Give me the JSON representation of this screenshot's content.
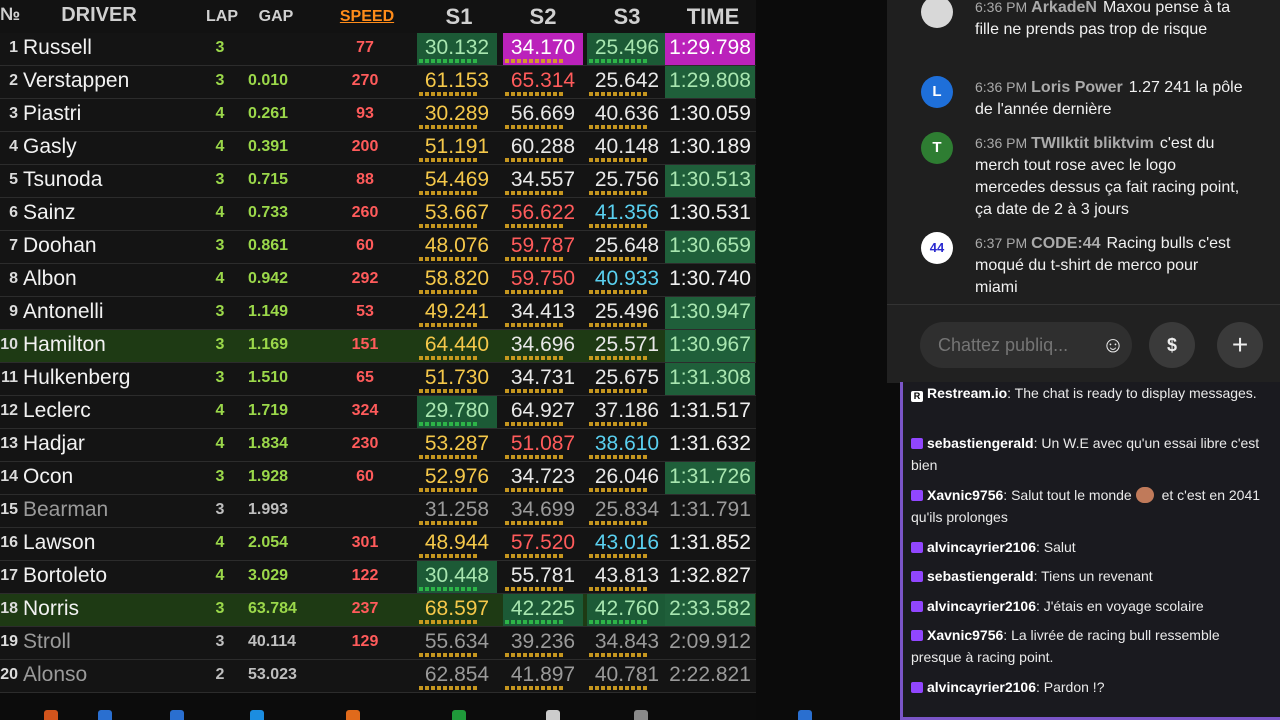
{
  "timing": {
    "headers": {
      "pos": "№",
      "driver": "DRIVER",
      "lap": "LAP",
      "gap": "GAP",
      "speed": "SPEED",
      "s1": "S1",
      "s2": "S2",
      "s3": "S3",
      "time": "TIME"
    },
    "header_colors": {
      "speed": "#ff8c1a",
      "default": "#d0d0d0"
    },
    "sector_colors": {
      "purple": "#bb22bb",
      "green_bg": "#1c5a36",
      "green_text": "#a8e6b0",
      "yellow": "#f5c84a",
      "red": "#ff5b5b",
      "white": "#e8e8e8",
      "cyan": "#5ad0f0",
      "green_time_bg": "#1f5f3a"
    },
    "rows": [
      {
        "pos": "1",
        "driver": "Russell",
        "lap": "3",
        "gap": "",
        "speed": "77",
        "s1": "30.132",
        "s2": "34.170",
        "s3": "25.496",
        "time": "1:29.798",
        "c1": "green",
        "c2": "purple",
        "c3": "green",
        "ct": "purple"
      },
      {
        "pos": "2",
        "driver": "Verstappen",
        "lap": "3",
        "gap": "0.010",
        "speed": "270",
        "s1": "61.153",
        "s2": "65.314",
        "s3": "25.642",
        "time": "1:29.808",
        "c1": "yellow",
        "c2": "red",
        "c3": "white",
        "ct": "green"
      },
      {
        "pos": "3",
        "driver": "Piastri",
        "lap": "4",
        "gap": "0.261",
        "speed": "93",
        "s1": "30.289",
        "s2": "56.669",
        "s3": "40.636",
        "time": "1:30.059",
        "c1": "yellow",
        "c2": "white",
        "c3": "white",
        "ct": "white"
      },
      {
        "pos": "4",
        "driver": "Gasly",
        "lap": "4",
        "gap": "0.391",
        "speed": "200",
        "s1": "51.191",
        "s2": "60.288",
        "s3": "40.148",
        "time": "1:30.189",
        "c1": "yellow",
        "c2": "white",
        "c3": "white",
        "ct": "white"
      },
      {
        "pos": "5",
        "driver": "Tsunoda",
        "lap": "3",
        "gap": "0.715",
        "speed": "88",
        "s1": "54.469",
        "s2": "34.557",
        "s3": "25.756",
        "time": "1:30.513",
        "c1": "yellow",
        "c2": "white",
        "c3": "white",
        "ct": "green"
      },
      {
        "pos": "6",
        "driver": "Sainz",
        "lap": "4",
        "gap": "0.733",
        "speed": "260",
        "s1": "53.667",
        "s2": "56.622",
        "s3": "41.356",
        "time": "1:30.531",
        "c1": "yellow",
        "c2": "red",
        "c3": "cyan",
        "ct": "white"
      },
      {
        "pos": "7",
        "driver": "Doohan",
        "lap": "3",
        "gap": "0.861",
        "speed": "60",
        "s1": "48.076",
        "s2": "59.787",
        "s3": "25.648",
        "time": "1:30.659",
        "c1": "yellow",
        "c2": "red",
        "c3": "white",
        "ct": "green"
      },
      {
        "pos": "8",
        "driver": "Albon",
        "lap": "4",
        "gap": "0.942",
        "speed": "292",
        "s1": "58.820",
        "s2": "59.750",
        "s3": "40.933",
        "time": "1:30.740",
        "c1": "yellow",
        "c2": "red",
        "c3": "cyan",
        "ct": "white"
      },
      {
        "pos": "9",
        "driver": "Antonelli",
        "lap": "3",
        "gap": "1.149",
        "speed": "53",
        "s1": "49.241",
        "s2": "34.413",
        "s3": "25.496",
        "time": "1:30.947",
        "c1": "yellow",
        "c2": "white",
        "c3": "white",
        "ct": "green"
      },
      {
        "pos": "10",
        "driver": "Hamilton",
        "lap": "3",
        "gap": "1.169",
        "speed": "151",
        "s1": "64.440",
        "s2": "34.696",
        "s3": "25.571",
        "time": "1:30.967",
        "c1": "yellow",
        "c2": "white",
        "c3": "white",
        "ct": "green",
        "hl": true
      },
      {
        "pos": "11",
        "driver": "Hulkenberg",
        "lap": "3",
        "gap": "1.510",
        "speed": "65",
        "s1": "51.730",
        "s2": "34.731",
        "s3": "25.675",
        "time": "1:31.308",
        "c1": "yellow",
        "c2": "white",
        "c3": "white",
        "ct": "green"
      },
      {
        "pos": "12",
        "driver": "Leclerc",
        "lap": "4",
        "gap": "1.719",
        "speed": "324",
        "s1": "29.780",
        "s2": "64.927",
        "s3": "37.186",
        "time": "1:31.517",
        "c1": "green",
        "c2": "white",
        "c3": "white",
        "ct": "white"
      },
      {
        "pos": "13",
        "driver": "Hadjar",
        "lap": "4",
        "gap": "1.834",
        "speed": "230",
        "s1": "53.287",
        "s2": "51.087",
        "s3": "38.610",
        "time": "1:31.632",
        "c1": "yellow",
        "c2": "red",
        "c3": "cyan",
        "ct": "white"
      },
      {
        "pos": "14",
        "driver": "Ocon",
        "lap": "3",
        "gap": "1.928",
        "speed": "60",
        "s1": "52.976",
        "s2": "34.723",
        "s3": "26.046",
        "time": "1:31.726",
        "c1": "yellow",
        "c2": "white",
        "c3": "white",
        "ct": "green"
      },
      {
        "pos": "15",
        "driver": "Bearman",
        "lap": "3",
        "gap": "1.993",
        "speed": "",
        "s1": "31.258",
        "s2": "34.699",
        "s3": "25.834",
        "time": "1:31.791",
        "c1": "white",
        "c2": "white",
        "c3": "white",
        "ct": "white",
        "dim": true
      },
      {
        "pos": "16",
        "driver": "Lawson",
        "lap": "4",
        "gap": "2.054",
        "speed": "301",
        "s1": "48.944",
        "s2": "57.520",
        "s3": "43.016",
        "time": "1:31.852",
        "c1": "yellow",
        "c2": "red",
        "c3": "cyan",
        "ct": "white"
      },
      {
        "pos": "17",
        "driver": "Bortoleto",
        "lap": "4",
        "gap": "3.029",
        "speed": "122",
        "s1": "30.448",
        "s2": "55.781",
        "s3": "43.813",
        "time": "1:32.827",
        "c1": "green",
        "c2": "white",
        "c3": "white",
        "ct": "white"
      },
      {
        "pos": "18",
        "driver": "Norris",
        "lap": "3",
        "gap": "63.784",
        "speed": "237",
        "s1": "68.597",
        "s2": "42.225",
        "s3": "42.760",
        "time": "2:33.582",
        "c1": "yellow",
        "c2": "green",
        "c3": "green",
        "ct": "green",
        "hl": true
      },
      {
        "pos": "19",
        "driver": "Stroll",
        "lap": "3",
        "gap": "40.114",
        "speed": "129",
        "s1": "55.634",
        "s2": "39.236",
        "s3": "34.843",
        "time": "2:09.912",
        "c1": "white",
        "c2": "white",
        "c3": "white",
        "ct": "white",
        "dim": true
      },
      {
        "pos": "20",
        "driver": "Alonso",
        "lap": "2",
        "gap": "53.023",
        "speed": "",
        "s1": "62.854",
        "s2": "41.897",
        "s3": "40.781",
        "time": "2:22.821",
        "c1": "white",
        "c2": "white",
        "c3": "white",
        "ct": "white",
        "dim": true
      }
    ]
  },
  "youtube_chat": {
    "messages": [
      {
        "time": "6:36 PM",
        "author": "ArkadeN",
        "text": "Maxou pense à ta fille ne prends pas trop de risque",
        "avatar_letter": "",
        "avatar_color": "#d8d8d8"
      },
      {
        "time": "6:36 PM",
        "author": "Loris Power",
        "text": "1.27 241 la pôle de l'année dernière",
        "avatar_letter": "L",
        "avatar_color": "#1e6fd9"
      },
      {
        "time": "6:36 PM",
        "author": "TWIlktit bliktvim",
        "text": "c'est du merch tout rose avec le logo mercedes dessus ça fait racing point, ça date de 2 à 3 jours",
        "avatar_letter": "T",
        "avatar_color": "#2e7d32"
      },
      {
        "time": "6:37 PM",
        "author": "CODE:44",
        "text": "Racing bulls c'est moqué du t-shirt de merco pour miami",
        "avatar_letter": "44",
        "avatar_color": "#ffffff"
      }
    ],
    "input_placeholder": "Chattez publiq...",
    "emoji_icon": "☺",
    "superchat_icon": "$",
    "add_icon": "+"
  },
  "restream_chat": {
    "messages": [
      {
        "user": "Restream.io",
        "text": ": The chat is ready to display messages.",
        "icon": "R"
      },
      {
        "user": "sebastiengerald",
        "text": ": Un W.E avec qu'un essai libre c'est bien",
        "icon": "twitch"
      },
      {
        "user": "Xavnic9756",
        "text": ": Salut tout le monde",
        "text2": " et c'est en 2041 qu'ils prolonges",
        "icon": "twitch",
        "emoji": true
      },
      {
        "user": "alvincayrier2106",
        "text": ": Salut",
        "icon": "twitch"
      },
      {
        "user": "sebastiengerald",
        "text": ": Tiens un revenant",
        "icon": "twitch"
      },
      {
        "user": "alvincayrier2106",
        "text": ": J'étais en voyage scolaire",
        "icon": "twitch"
      },
      {
        "user": "Xavnic9756",
        "text": ": La livrée de racing bull ressemble presque à racing point.",
        "icon": "twitch"
      },
      {
        "user": "alvincayrier2106",
        "text": ": Pardon !?",
        "icon": "twitch"
      }
    ]
  }
}
